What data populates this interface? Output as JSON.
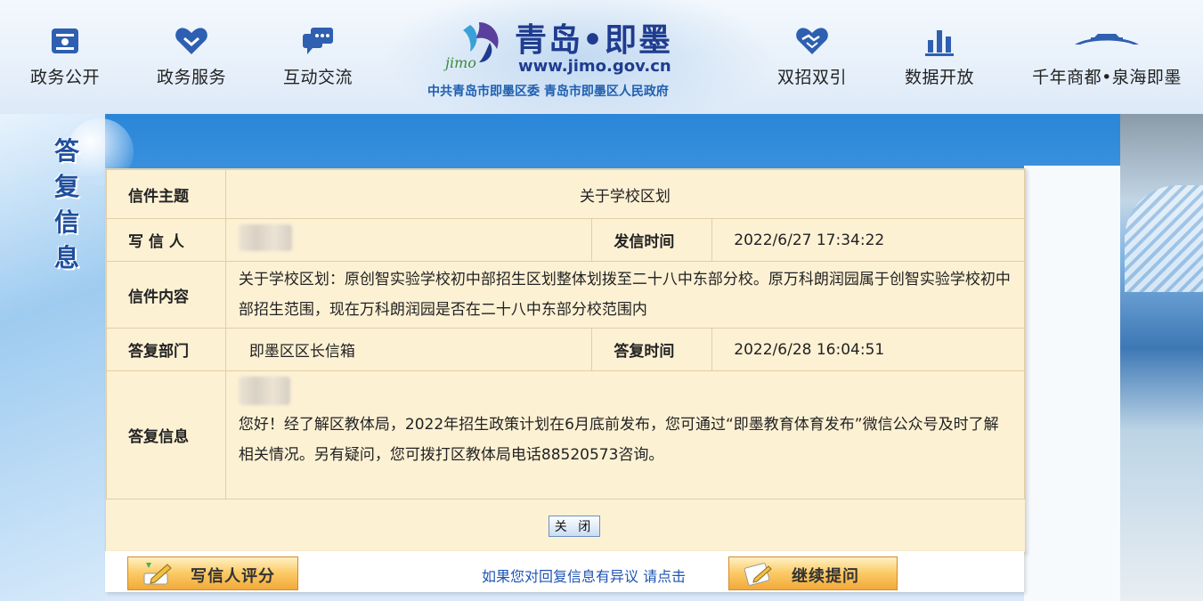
{
  "header": {
    "nav_left": [
      {
        "label": "政务公开",
        "icon": "id-card-icon"
      },
      {
        "label": "政务服务",
        "icon": "heart-chevron-icon"
      },
      {
        "label": "互动交流",
        "icon": "chat-bubble-icon"
      }
    ],
    "nav_right": [
      {
        "label": "双招双引",
        "icon": "handshake-heart-icon"
      },
      {
        "label": "数据开放",
        "icon": "bar-chart-icon"
      },
      {
        "label": "千年商都•泉海即墨",
        "icon": "pavilion-icon"
      }
    ],
    "logo": {
      "title": "青岛•即墨",
      "url": "www.jimo.gov.cn",
      "subtitle": "中共青岛市即墨区委  青岛市即墨区人民政府",
      "mark_text": "jimo"
    }
  },
  "section_title": "答复信息",
  "letter": {
    "subject_label": "信件主题",
    "subject": "关于学校区划",
    "writer_label": "写 信 人",
    "sent_time_label": "发信时间",
    "sent_time": "2022/6/27 17:34:22",
    "content_label": "信件内容",
    "content": "关于学校区划：原创智实验学校初中部招生区划整体划拨至二十八中东部分校。原万科朗润园属于创智实验学校初中部招生范围，现在万科朗润园是否在二十八中东部分校范围内",
    "dept_label": "答复部门",
    "dept": "即墨区区长信箱",
    "reply_time_label": "答复时间",
    "reply_time": "2022/6/28 16:04:51",
    "reply_label": "答复信息",
    "reply": "您好！经了解区教体局，2022年招生政策计划在6月底前发布，您可通过“即墨教育体育发布”微信公众号及时了解相关情况。另有疑问，您可拨打区教体局电话88520573咨询。"
  },
  "buttons": {
    "close": "关 闭",
    "rate": "写信人评分",
    "hint": "如果您对回复信息有异议 请点击",
    "continue": "继续提问"
  },
  "colors": {
    "label_blue": "#1746a8",
    "panel_bg": "#fdf1d4",
    "link_blue": "#1f54b5",
    "button_orange": "#f2a93a"
  }
}
